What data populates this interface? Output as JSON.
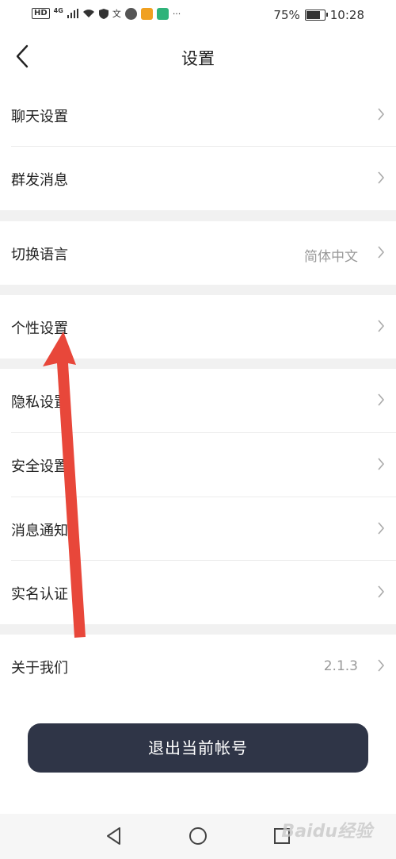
{
  "status_bar": {
    "hd": "HD",
    "network": "4G",
    "battery": "75%",
    "time": "10:28",
    "dots": "···"
  },
  "header": {
    "title": "设置"
  },
  "rows": {
    "chat_settings": {
      "label": "聊天设置"
    },
    "broadcast": {
      "label": "群发消息"
    },
    "language": {
      "label": "切换语言",
      "value": "简体中文"
    },
    "personal": {
      "label": "个性设置"
    },
    "privacy": {
      "label": "隐私设置"
    },
    "security": {
      "label": "安全设置"
    },
    "notifications": {
      "label": "消息通知"
    },
    "real_name": {
      "label": "实名认证"
    },
    "about": {
      "label": "关于我们",
      "value": "2.1.3"
    }
  },
  "logout_label": "退出当前帐号",
  "watermark": "Baidu经验",
  "colors": {
    "button_bg": "#2f3547",
    "arrow": "#e8473a",
    "gap": "#f1f1f1"
  }
}
